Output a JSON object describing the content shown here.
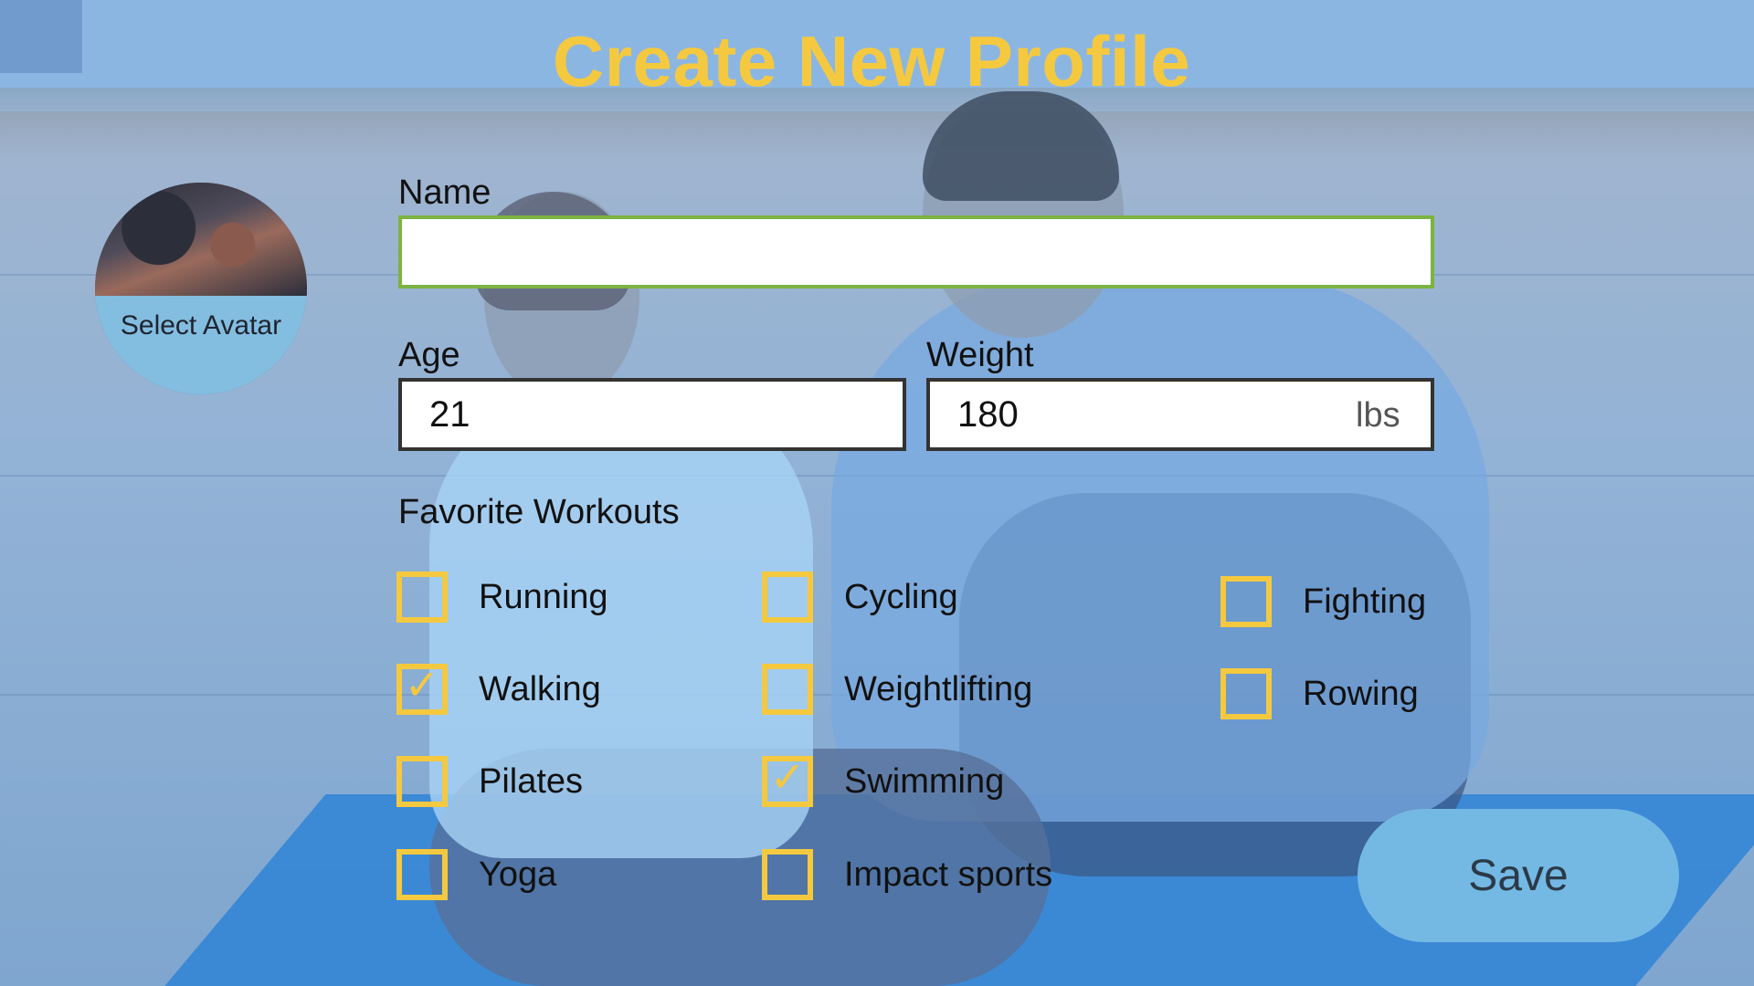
{
  "page": {
    "title": "Create New Profile"
  },
  "avatar": {
    "label": "Select Avatar"
  },
  "form": {
    "name": {
      "label": "Name",
      "value": ""
    },
    "age": {
      "label": "Age",
      "value": "21"
    },
    "weight": {
      "label": "Weight",
      "value": "180",
      "unit": "lbs"
    }
  },
  "workouts": {
    "label": "Favorite Workouts",
    "options": [
      {
        "label": "Running",
        "checked": false
      },
      {
        "label": "Walking",
        "checked": true
      },
      {
        "label": "Pilates",
        "checked": false
      },
      {
        "label": "Yoga",
        "checked": false
      },
      {
        "label": "Cycling",
        "checked": false
      },
      {
        "label": "Weightlifting",
        "checked": false
      },
      {
        "label": "Swimming",
        "checked": true
      },
      {
        "label": "Impact sports",
        "checked": false
      },
      {
        "label": "Fighting",
        "checked": false
      },
      {
        "label": "Rowing",
        "checked": false
      }
    ]
  },
  "actions": {
    "save_label": "Save"
  },
  "colors": {
    "accent": "#f5c93f",
    "name_border": "#7cb342",
    "save_button": "#74b9e4",
    "avatar_label_bg": "#83bde0"
  },
  "icons": {
    "check": "checkmark-icon"
  }
}
